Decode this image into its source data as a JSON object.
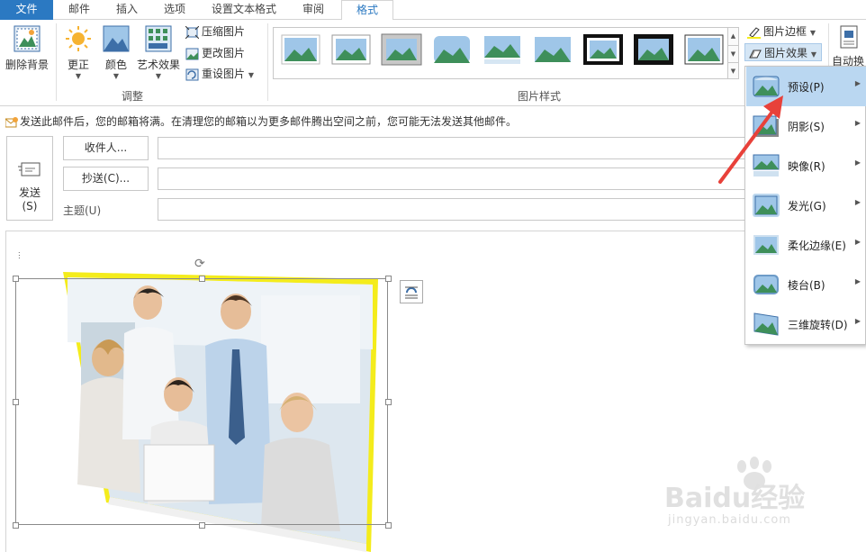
{
  "tabs": [
    "文件",
    "邮件",
    "插入",
    "选项",
    "设置文本格式",
    "审阅",
    "格式"
  ],
  "ribbon": {
    "remove_background": "删除背景",
    "corrections": "更正",
    "color": "颜色",
    "artistic_effects": "艺术效果",
    "compress": "压缩图片",
    "change": "更改图片",
    "reset": "重设图片",
    "adjust_group": "调整",
    "styles_group": "图片样式",
    "border": "图片边框",
    "effects": "图片效果",
    "auto_wrap": "自动换"
  },
  "info_bar": "发送此邮件后，您的邮箱将满。在清理您的邮箱以为更多邮件腾出空间之前，您可能无法发送其他邮件。",
  "compose": {
    "send_line1": "发送",
    "send_line2": "(S)",
    "to_button": "收件人...",
    "cc_button": "抄送(C)...",
    "subject_label": "主题(U)"
  },
  "effects_menu": [
    {
      "label": "预设(P)",
      "highlighted": true
    },
    {
      "label": "阴影(S)",
      "highlighted": false
    },
    {
      "label": "映像(R)",
      "highlighted": false
    },
    {
      "label": "发光(G)",
      "highlighted": false
    },
    {
      "label": "柔化边缘(E)",
      "highlighted": false
    },
    {
      "label": "棱台(B)",
      "highlighted": false
    },
    {
      "label": "三维旋转(D)",
      "highlighted": false
    }
  ],
  "watermark": {
    "text": "Baidu经验",
    "url": "jingyan.baidu.com"
  },
  "colors": {
    "file_tab": "#2b79c2",
    "accent": "#2b79c2",
    "menu_highlight": "#bad7f1",
    "picture_border": "#f4ec1c",
    "arrow": "#e8413a"
  }
}
